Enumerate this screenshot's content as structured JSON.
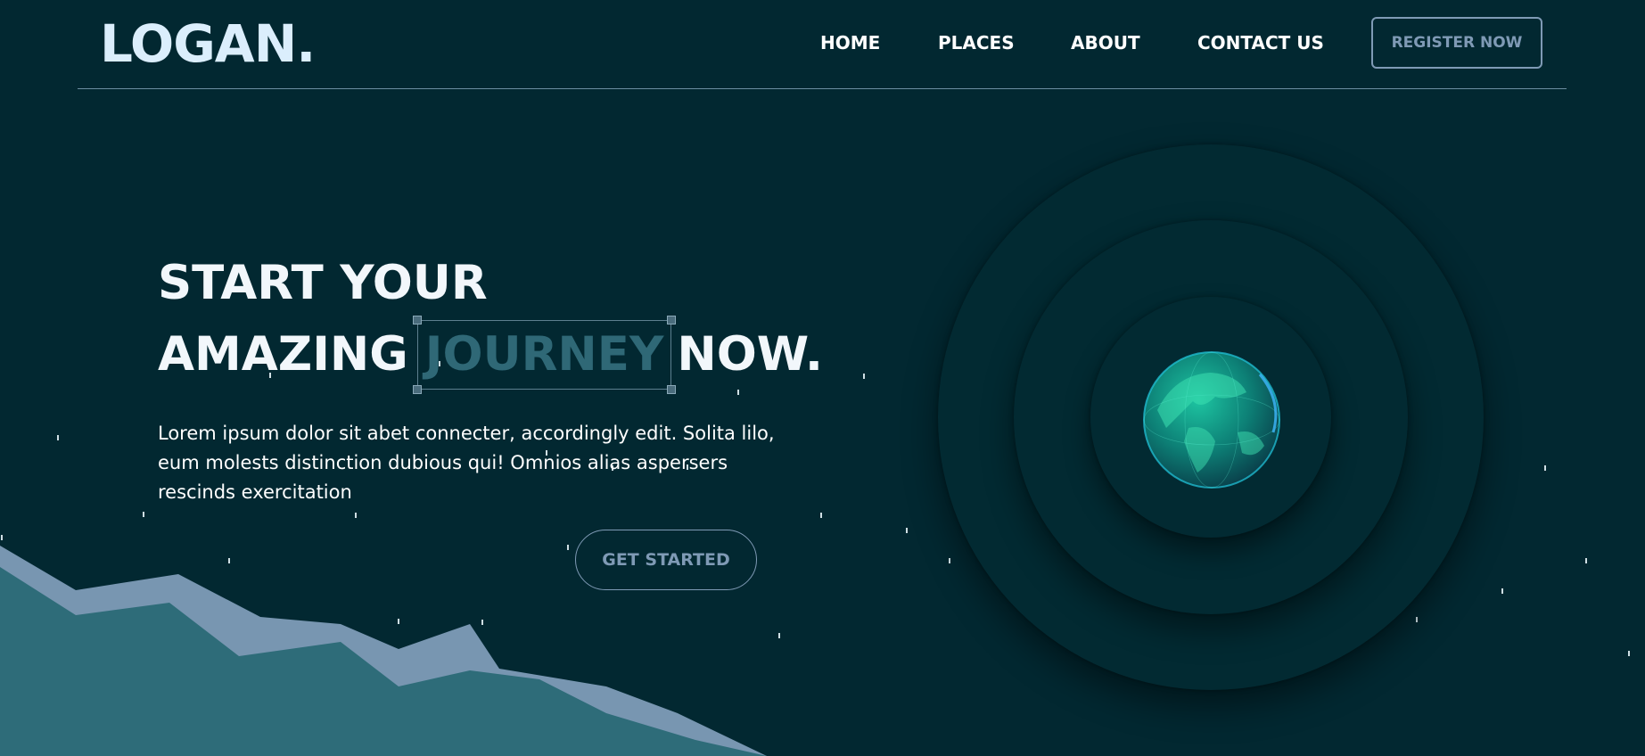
{
  "header": {
    "logo": "LOGAN.",
    "nav": [
      {
        "label": "HOME"
      },
      {
        "label": "PLACES"
      },
      {
        "label": "ABOUT"
      },
      {
        "label": "CONTACT US"
      }
    ],
    "register_label": "REGISTER NOW"
  },
  "hero": {
    "title_line1": "START YOUR",
    "title_line2_start": "AMAZING",
    "title_accent": "JOURNEY",
    "title_line2_end": "NOW.",
    "description": "Lorem ipsum dolor sit abet connecter, accordingly edit. Solita lilo, eum molests distinction dubious qui! Omnios alias aspersers rescinds exercitation",
    "cta_label": "GET STARTED"
  },
  "colors": {
    "background": "#022831",
    "logo": "#dbeefc",
    "accent": "#2f6876",
    "button_outline": "#7f9ab5",
    "mountain_front": "#2e6c79",
    "mountain_back": "#7896b1",
    "globe": "#1fc3a4"
  },
  "icons": [
    "globe-icon",
    "mountain-graphic"
  ]
}
